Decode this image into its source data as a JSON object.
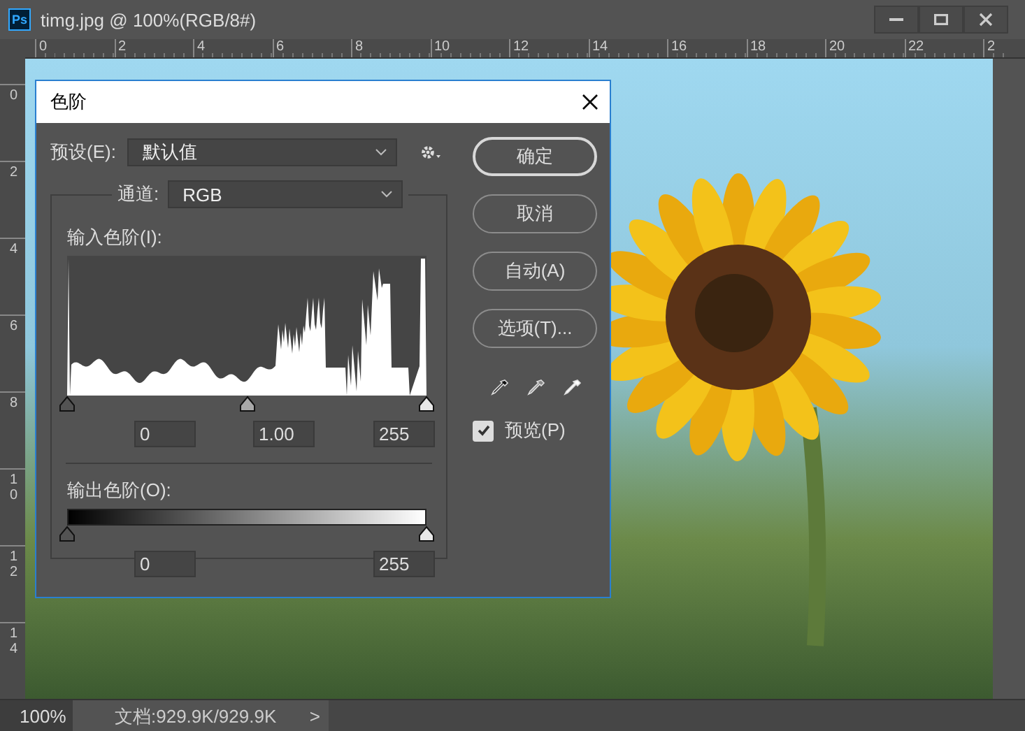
{
  "window": {
    "app_icon": "Ps",
    "title": "timg.jpg @ 100%(RGB/8#)"
  },
  "rulers": {
    "horizontal": [
      "0",
      "2",
      "4",
      "6",
      "8",
      "10",
      "12",
      "14",
      "16",
      "18",
      "20",
      "22",
      "2"
    ],
    "vertical": [
      "0",
      "2",
      "4",
      "6",
      "8",
      "10",
      "12",
      "14"
    ]
  },
  "dialog": {
    "title": "色阶",
    "preset": {
      "label": "预设(E):",
      "value": "默认值"
    },
    "channel": {
      "label": "通道:",
      "value": "RGB"
    },
    "input_levels": {
      "label": "输入色阶(I):",
      "handles": [
        {
          "kind": "black",
          "level": 0
        },
        {
          "kind": "gray",
          "level": 0.5
        },
        {
          "kind": "white",
          "level": 1
        }
      ],
      "fields": [
        "0",
        "1.00",
        "255"
      ]
    },
    "output_levels": {
      "label": "输出色阶(O):",
      "handles": [
        {
          "kind": "black",
          "level": 0
        },
        {
          "kind": "white",
          "level": 1
        }
      ],
      "fields": [
        "0",
        "255"
      ]
    },
    "buttons": [
      {
        "label": "确定",
        "default": true
      },
      {
        "label": "取消",
        "default": false
      },
      {
        "label": "自动(A)",
        "default": false
      },
      {
        "label": "选项(T)...",
        "default": false
      }
    ],
    "preview": {
      "label": "预览(P)",
      "checked": true
    }
  },
  "status_bar": {
    "zoom": "100%",
    "doc_info": "文档:929.9K/929.9K",
    "arrow": ">"
  }
}
